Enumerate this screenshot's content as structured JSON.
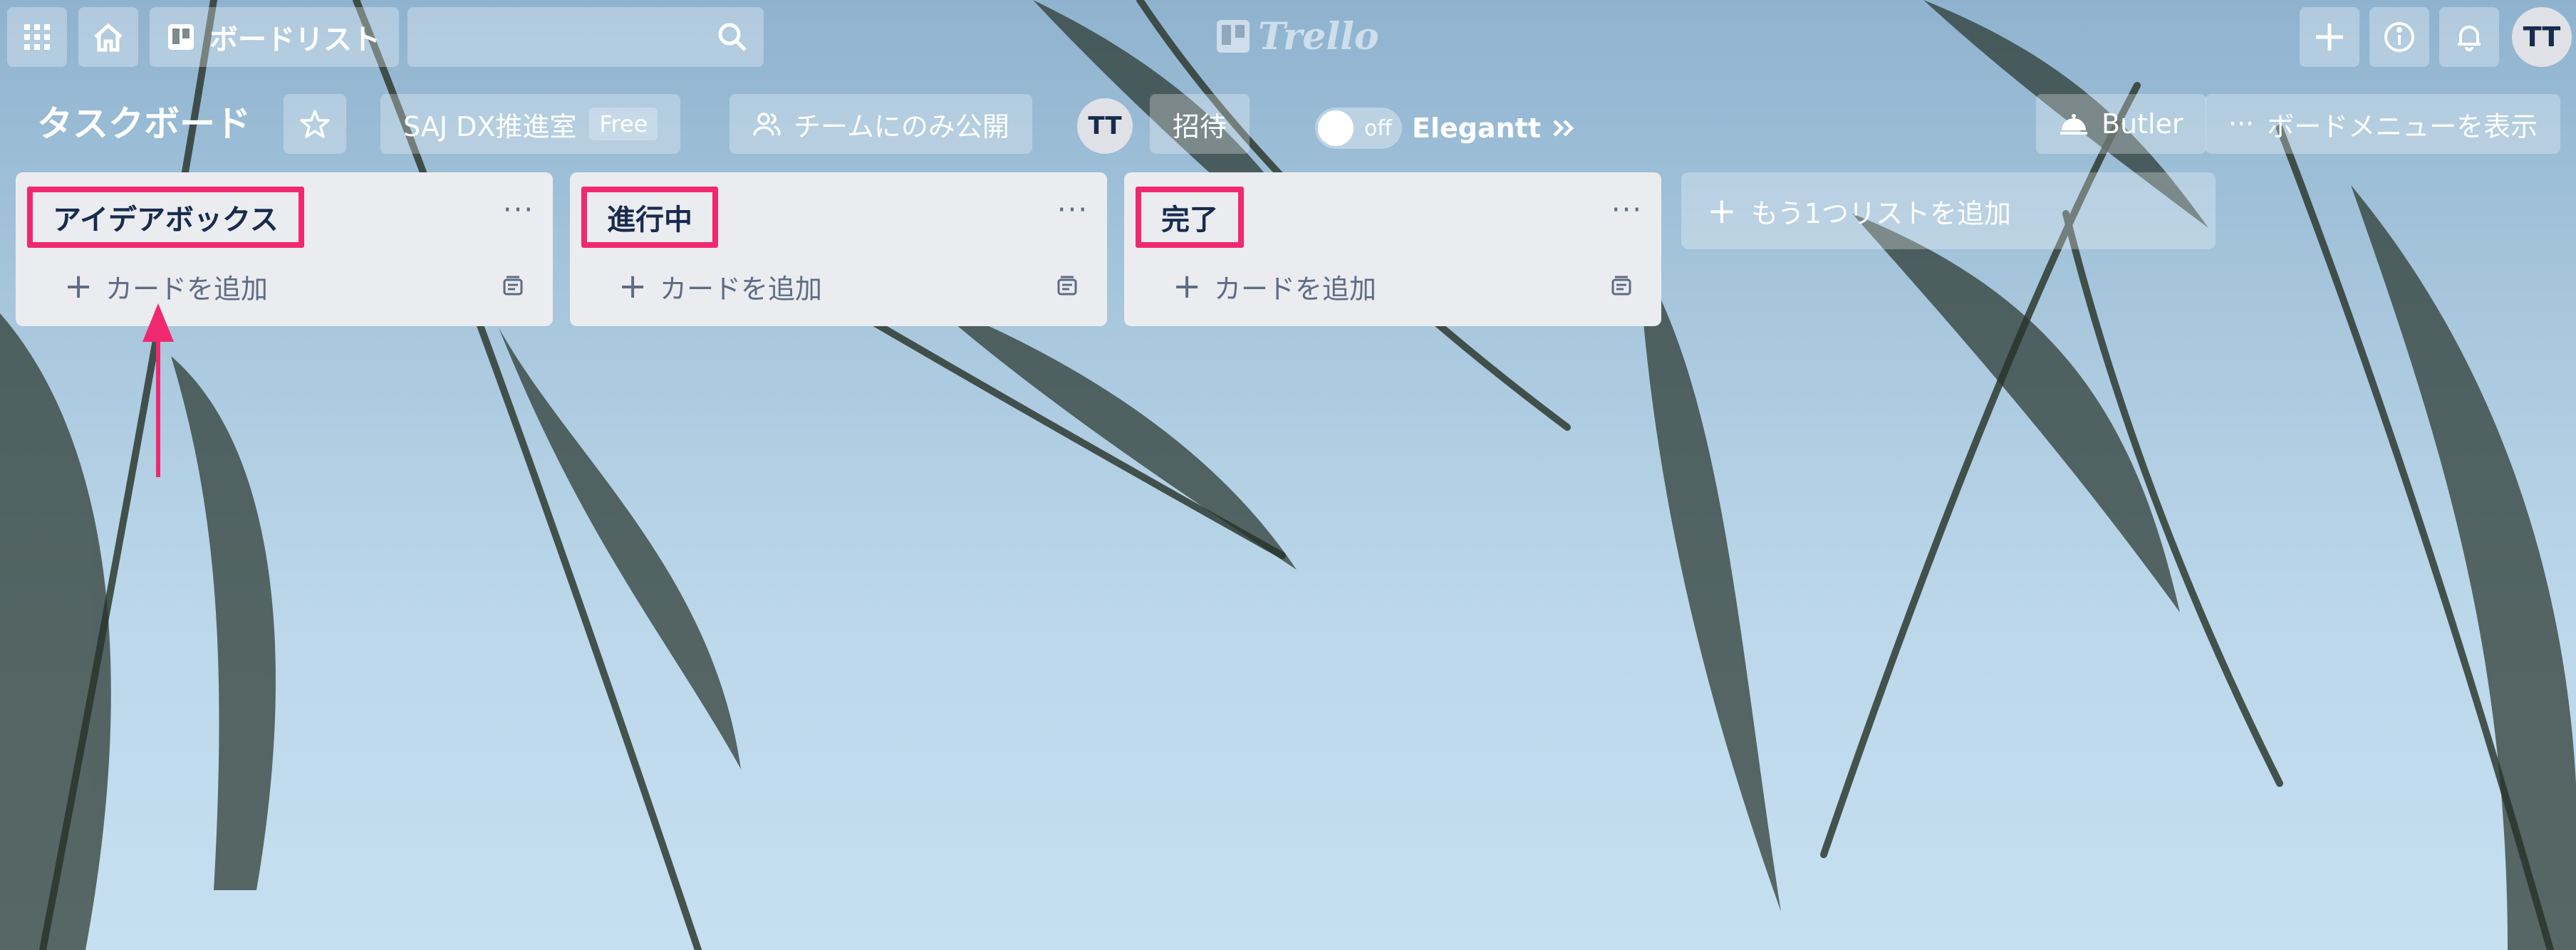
{
  "colors": {
    "accent_highlight": "#f0296e",
    "list_background": "#ebecf0",
    "text_dark": "#172b4d",
    "text_muted": "#5e6c84"
  },
  "topbar": {
    "apps_icon": "grid-icon",
    "home_icon": "home-icon",
    "board_list_label": "ボードリスト",
    "search_icon": "search-icon",
    "logo_text": "Trello",
    "create_icon": "plus-icon",
    "info_icon": "info-icon",
    "notification_icon": "bell-icon",
    "user_initials": "TT"
  },
  "board": {
    "title": "タスクボード",
    "star_icon": "star-icon",
    "team_name": "SAJ DX推進室",
    "plan_badge": "Free",
    "visibility_label": "チームにのみ公開",
    "member_initials": "TT",
    "invite_label": "招待",
    "toggle_state": "off",
    "power_up_label": "Elegantt",
    "butler_label": "Butler",
    "menu_label": "ボードメニューを表示"
  },
  "lists": [
    {
      "title": "アイデアボックス",
      "add_card_label": "カードを追加"
    },
    {
      "title": "進行中",
      "add_card_label": "カードを追加"
    },
    {
      "title": "完了",
      "add_card_label": "カードを追加"
    }
  ],
  "list_menu_glyph": "···",
  "add_list_label": "もう1つリストを追加"
}
